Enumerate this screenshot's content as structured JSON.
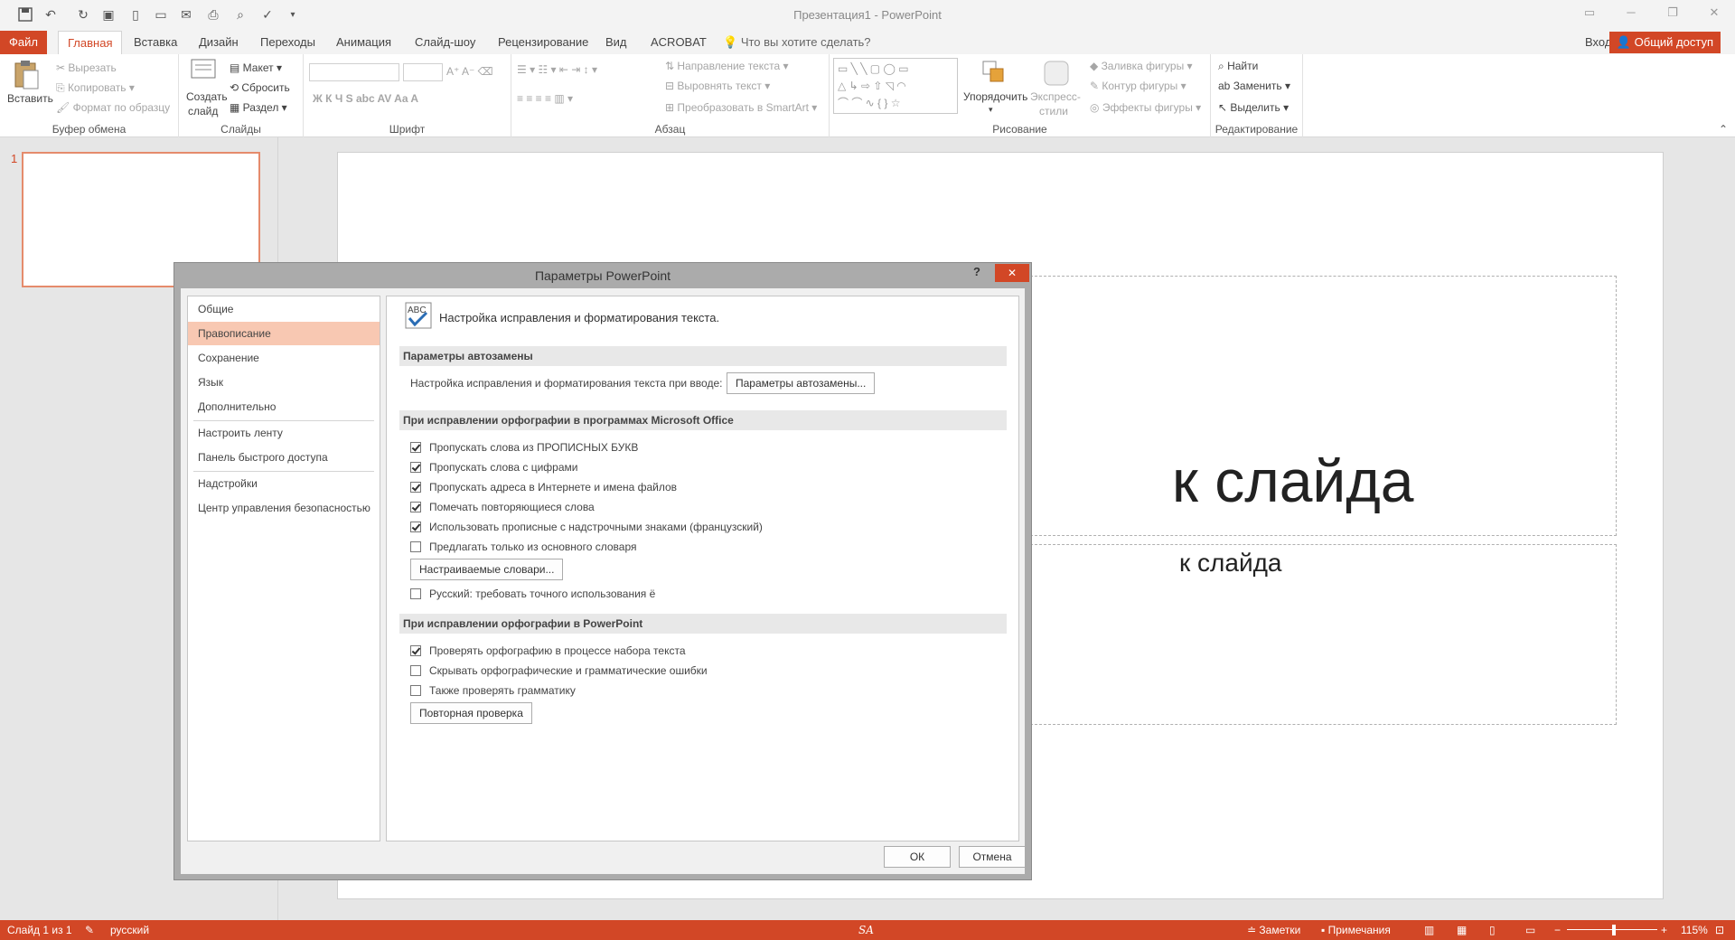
{
  "window": {
    "title": "Презентация1 - PowerPoint"
  },
  "tabs": {
    "file": "Файл",
    "home": "Главная",
    "insert": "Вставка",
    "design": "Дизайн",
    "transitions": "Переходы",
    "animation": "Анимация",
    "slideshow": "Слайд-шоу",
    "review": "Рецензирование",
    "view": "Вид",
    "acrobat": "ACROBAT",
    "tell": "Что вы хотите сделать?",
    "signin": "Вход",
    "share": "Общий доступ"
  },
  "ribbon": {
    "clipboard": {
      "paste": "Вставить",
      "cut": "Вырезать",
      "copy": "Копировать",
      "format_painter": "Формат по образцу",
      "label": "Буфер обмена"
    },
    "slides": {
      "new_slide": "Создать",
      "new_slide2": "слайд",
      "layout": "Макет",
      "reset": "Сбросить",
      "section": "Раздел",
      "label": "Слайды"
    },
    "font": {
      "label": "Шрифт"
    },
    "paragraph": {
      "text_direction": "Направление текста",
      "align_text": "Выровнять текст",
      "smartart": "Преобразовать в SmartArt",
      "label": "Абзац"
    },
    "drawing": {
      "arrange": "Упорядочить",
      "quick_styles": "Экспресс-",
      "quick_styles2": "стили",
      "fill": "Заливка фигуры",
      "outline": "Контур фигуры",
      "effects": "Эффекты фигуры",
      "label": "Рисование"
    },
    "editing": {
      "find": "Найти",
      "replace": "Заменить",
      "select": "Выделить",
      "label": "Редактирование"
    }
  },
  "thumbs": {
    "number": "1"
  },
  "slide": {
    "title_fragment": "к слайда",
    "subtitle_fragment": "к слайда"
  },
  "dialog": {
    "title": "Параметры PowerPoint",
    "help": "?",
    "nav": [
      "Общие",
      "Правописание",
      "Сохранение",
      "Язык",
      "Дополнительно",
      "Настроить ленту",
      "Панель быстрого доступа",
      "Надстройки",
      "Центр управления безопасностью"
    ],
    "heading": "Настройка исправления и форматирования текста.",
    "autocorrect": {
      "section": "Параметры автозамены",
      "label": "Настройка исправления и форматирования текста при вводе:",
      "button": "Параметры автозамены..."
    },
    "office": {
      "section": "При исправлении орфографии в программах Microsoft Office",
      "options": [
        {
          "label": "Пропускать слова из ПРОПИСНЫХ БУКВ",
          "checked": true
        },
        {
          "label": "Пропускать слова с цифрами",
          "checked": true
        },
        {
          "label": "Пропускать адреса в Интернете и имена файлов",
          "checked": true
        },
        {
          "label": "Помечать повторяющиеся слова",
          "checked": true
        },
        {
          "label": "Использовать прописные с надстрочными знаками (французский)",
          "checked": true
        },
        {
          "label": "Предлагать только из основного словаря",
          "checked": false
        }
      ],
      "dict_button": "Настраиваемые словари...",
      "yo_option": {
        "label": "Русский: требовать точного использования ё",
        "checked": false
      }
    },
    "ppt": {
      "section": "При исправлении орфографии в PowerPoint",
      "options": [
        {
          "label": "Проверять орфографию в процессе набора текста",
          "checked": true
        },
        {
          "label": "Скрывать орфографические и грамматические ошибки",
          "checked": false
        },
        {
          "label": "Также проверять грамматику",
          "checked": false
        }
      ],
      "recheck_button": "Повторная проверка"
    },
    "ok": "ОК",
    "cancel": "Отмена"
  },
  "status": {
    "slide": "Слайд 1 из 1",
    "language": "русский",
    "notes": "Заметки",
    "comments": "Примечания",
    "zoom": "115%",
    "sa": "SA"
  },
  "colors": {
    "accent": "#d24726",
    "selected_nav": "#f8c8b2"
  }
}
